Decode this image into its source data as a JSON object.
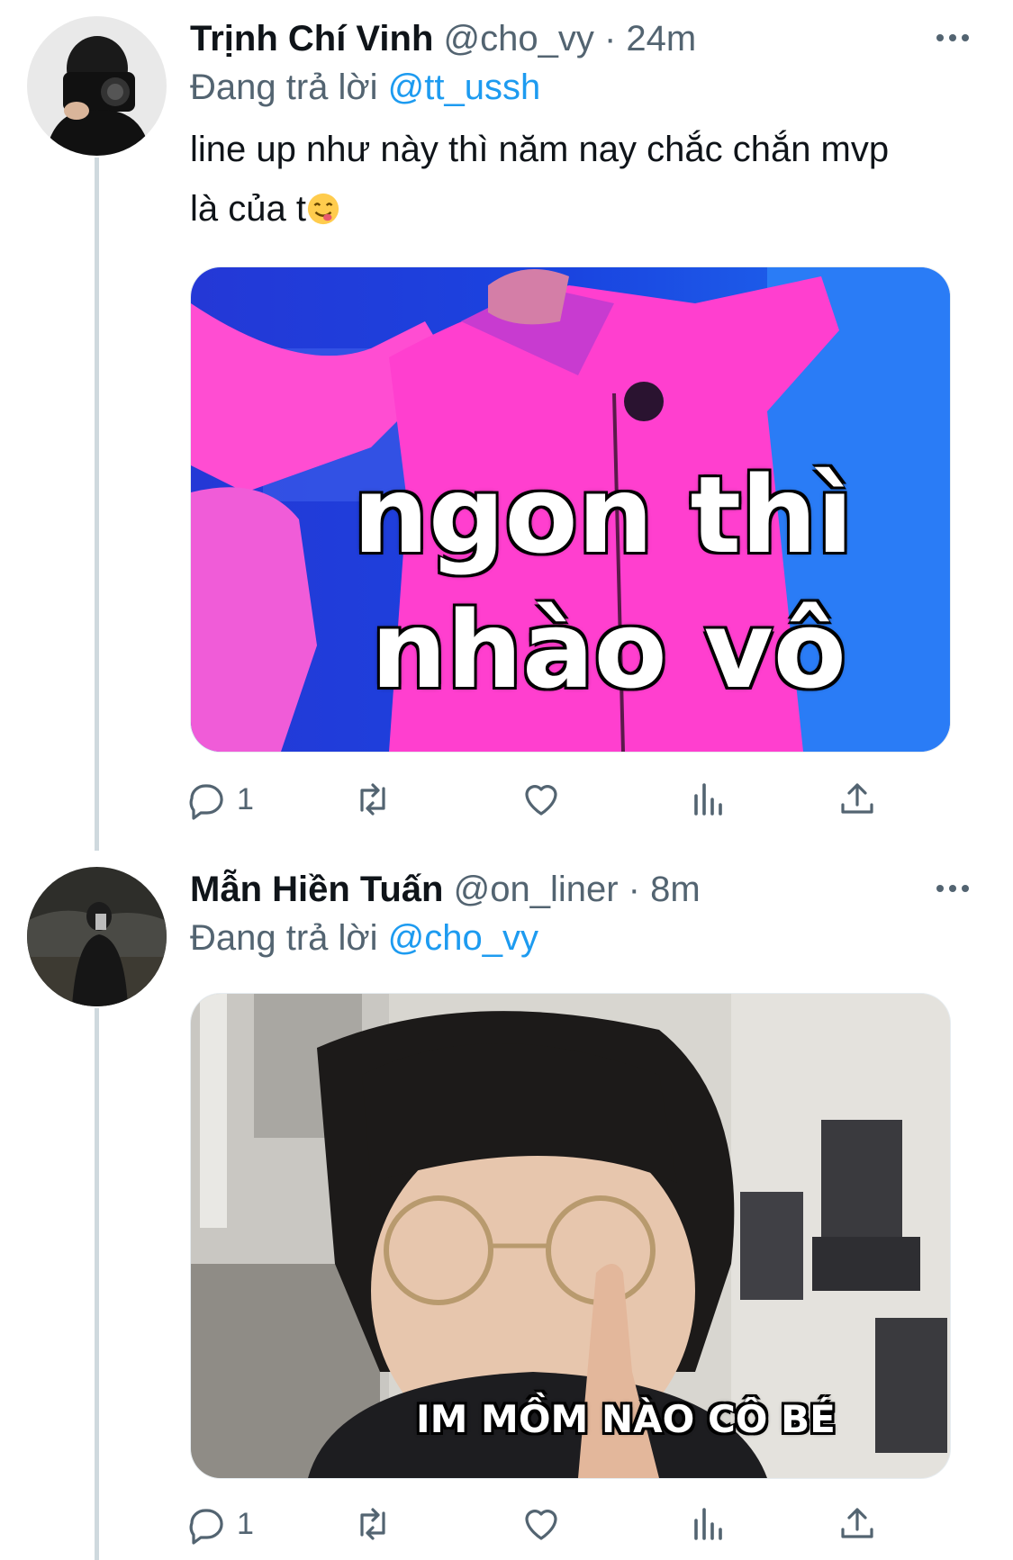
{
  "tweets": [
    {
      "name": "Trịnh Chí Vinh",
      "handle": "@cho_vy",
      "dot": "·",
      "time": "24m",
      "reply_prefix": "Đang trả lời",
      "reply_to": "@tt_ussh",
      "text_line1": "line up như này thì năm nay chắc chắn mvp",
      "text_line2": "là của t",
      "emoji": "savoring-food-emoji",
      "media_caption_line1": "ngon thì",
      "media_caption_line2": "nhào vô",
      "reply_count": "1"
    },
    {
      "name": "Mẫn Hiền Tuấn",
      "handle": "@on_liner",
      "dot": "·",
      "time": "8m",
      "reply_prefix": "Đang trả lời",
      "reply_to": "@cho_vy",
      "media_caption": "IM MỒM NÀO CÔ BÉ",
      "reply_count": "1"
    }
  ],
  "icons": {
    "reply": "reply-icon",
    "retweet": "retweet-icon",
    "like": "heart-icon",
    "views": "views-icon",
    "share": "share-icon",
    "more": "more-icon"
  },
  "colors": {
    "link": "#1d9bf0",
    "secondary": "#536471",
    "thread": "#cfd9de"
  }
}
